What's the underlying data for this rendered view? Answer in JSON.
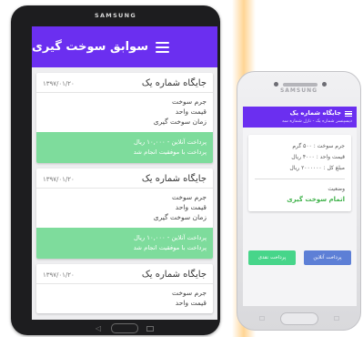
{
  "tablet": {
    "brand": "SAMSUNG",
    "title": "سوابق سوخت گیری",
    "cards": [
      {
        "station": "جایگاه شماره یک",
        "date": "۱۳۹۷/۰۱/۲۰",
        "lines": [
          "جرم سوخت",
          "قیمت واحد",
          "زمان سوخت گیری"
        ],
        "payment": "پرداخت آنلاین - ۱۰,۰۰۰ ریال",
        "result": "پرداخت با موفقیت انجام شد"
      },
      {
        "station": "جایگاه شماره یک",
        "date": "۱۳۹۷/۰۱/۲۰",
        "lines": [
          "جرم سوخت",
          "قیمت واحد",
          "زمان سوخت گیری"
        ],
        "payment": "پرداخت آنلاین - ۱۰,۰۰۰ ریال",
        "result": "پرداخت با موفقیت انجام شد"
      },
      {
        "station": "جایگاه شماره یک",
        "date": "۱۳۹۷/۰۱/۲۰",
        "lines": [
          "جرم سوخت",
          "قیمت واحد"
        ]
      }
    ]
  },
  "phone": {
    "brand": "SAMSUNG",
    "title": "جایگاه شماره یک",
    "subtitle": "دیسپنسر شماره یک - نازل شماره سه",
    "fuel_mass": "جرم سوخت : ۵۰۰ گرم",
    "unit_price": "قیمت واحد : ۴۰۰۰ ریال",
    "total": "مبلغ کل : ۲۰۰۰۰۰۰ ریال",
    "status_label": "وضعیت",
    "status_value": "اتمام سوخت گیری",
    "btn_online": "پرداخت آنلاین",
    "btn_cash": "پرداخت نقدی"
  },
  "colors": {
    "accent": "#6b2ff0",
    "success_panel": "#7edc9c",
    "status_green": "#3fb24a",
    "btn_online": "#5d7fd6",
    "btn_cash": "#47d58a"
  },
  "icons": [
    "hamburger-menu-icon",
    "back-nav-icon",
    "home-nav-icon",
    "recent-apps-nav-icon"
  ]
}
